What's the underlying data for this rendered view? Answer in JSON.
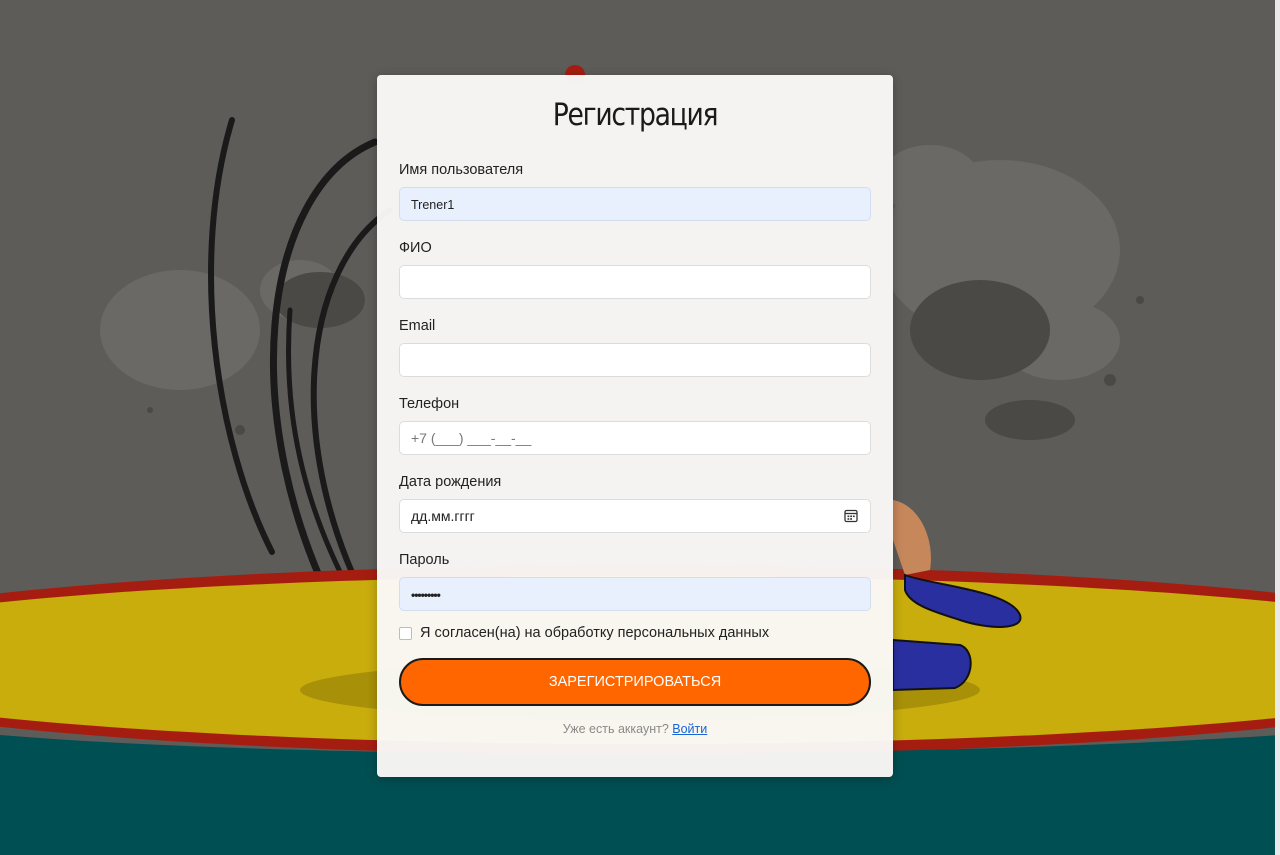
{
  "form": {
    "title": "Регистрация",
    "fields": {
      "username": {
        "label": "Имя пользователя",
        "value": "Trener1"
      },
      "fullname": {
        "label": "ФИО",
        "value": ""
      },
      "email": {
        "label": "Email",
        "value": ""
      },
      "phone": {
        "label": "Телефон",
        "placeholder": "+7 (___) ___-__-__"
      },
      "birthdate": {
        "label": "Дата рождения",
        "value": "дд.мм.гггг",
        "icon": "calendar-icon"
      },
      "password": {
        "label": "Пароль",
        "masked_value": "•••••••••"
      }
    },
    "consent_label": "Я согласен(на) на обработку персональных данных",
    "consent_checked": false,
    "submit_label": "ЗАРЕГИСТРИРОВАТЬСЯ",
    "login_prompt": "Уже есть аккаунт?",
    "login_link": "Войти"
  },
  "colors": {
    "accent": "#ff6600",
    "link": "#1a64d6",
    "autofill": "#e8f0fe",
    "mat_yellow": "#c8ad0c",
    "floor_teal": "#004f52",
    "wall": "#5e5d59"
  }
}
